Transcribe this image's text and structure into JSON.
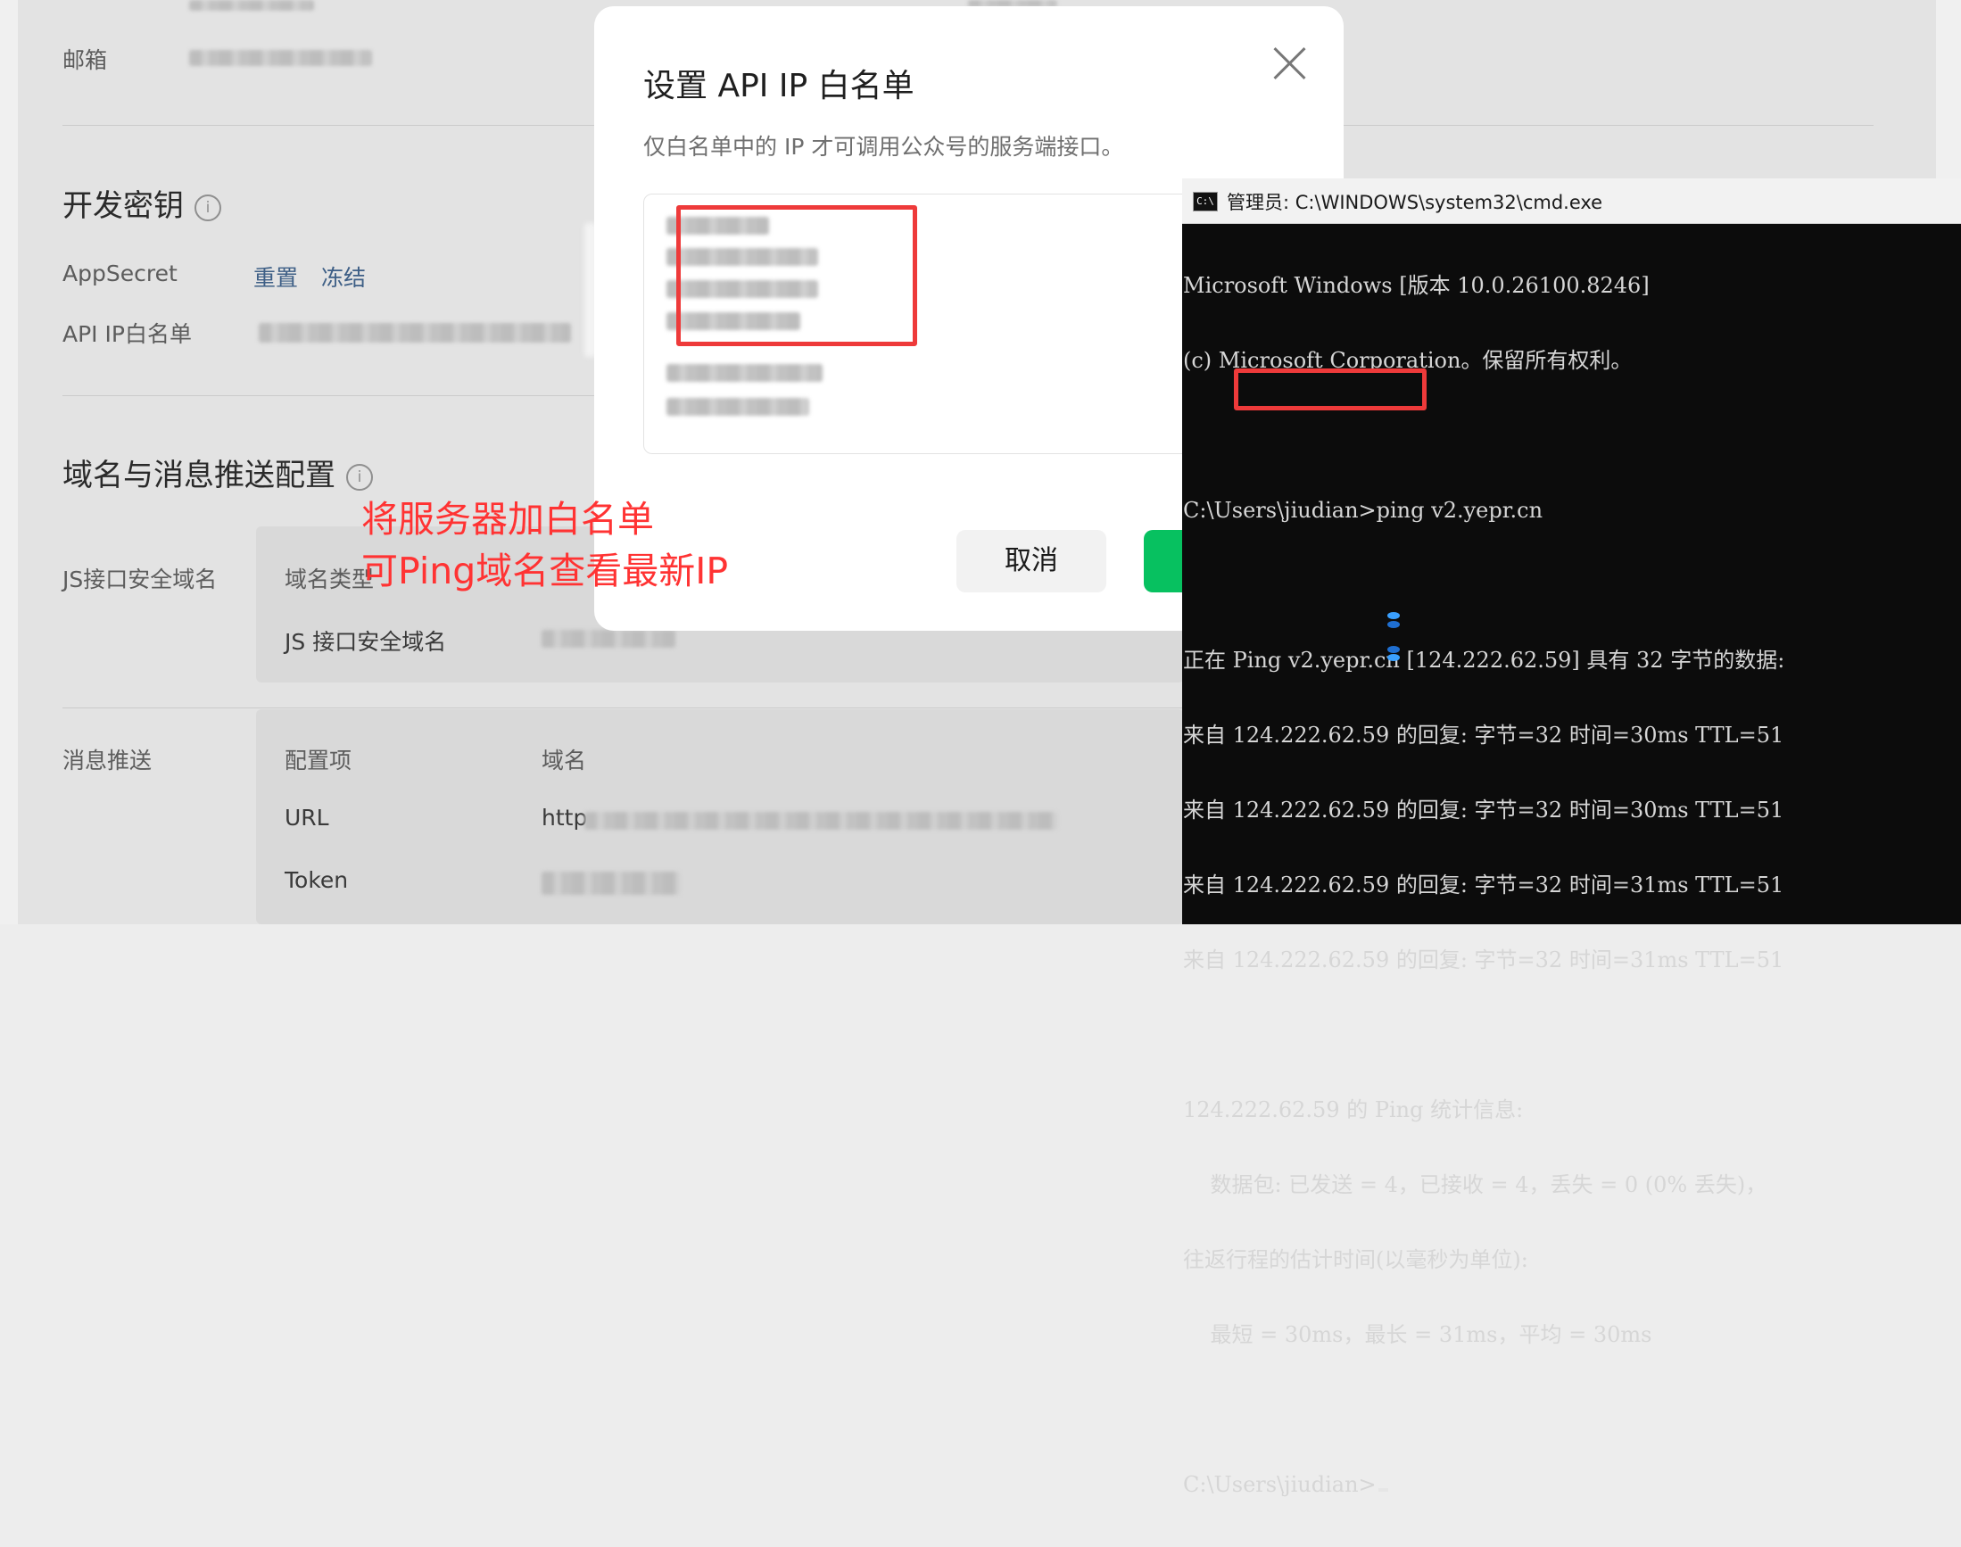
{
  "background": {
    "email_label": "邮箱",
    "dev_key_title": "开发密钥",
    "app_secret_label": "AppSecret",
    "reset_link": "重置",
    "freeze_link": "冻结",
    "api_ip_label": "API IP白名单",
    "domain_config_title": "域名与消息推送配置",
    "js_domain_label": "JS接口安全域名",
    "domain_type_label": "域名类型",
    "js_domain_field_label": "JS 接口安全域名",
    "push_label": "消息推送",
    "config_item_label": "配置项",
    "domain_col_label": "域名",
    "url_label": "URL",
    "url_value_prefix": "http",
    "token_label": "Token"
  },
  "modal": {
    "title": "设置 API IP 白名单",
    "description": "仅白名单中的 IP 才可调用公众号的服务端接口。",
    "cancel_label": "取消"
  },
  "annotation": {
    "line1": "将服务器加白名单",
    "line2": "可Ping域名查看最新IP",
    "color": "#ff3333"
  },
  "cmd": {
    "title": "管理员: C:\\WINDOWS\\system32\\cmd.exe",
    "lines": [
      "Microsoft Windows [版本 10.0.26100.8246]",
      "(c) Microsoft Corporation。保留所有权利。",
      "",
      "C:\\Users\\jiudian>ping v2.yepr.cn",
      "",
      "正在 Ping v2.yepr.cn [124.222.62.59] 具有 32 字节的数据:",
      "来自 124.222.62.59 的回复: 字节=32 时间=30ms TTL=51",
      "来自 124.222.62.59 的回复: 字节=32 时间=30ms TTL=51",
      "来自 124.222.62.59 的回复: 字节=32 时间=31ms TTL=51",
      "来自 124.222.62.59 的回复: 字节=32 时间=31ms TTL=51",
      "",
      "124.222.62.59 的 Ping 统计信息:",
      "    数据包: 已发送 = 4，已接收 = 4，丢失 = 0 (0% 丢失)，",
      "往返行程的估计时间(以毫秒为单位):",
      "    最短 = 30ms，最长 = 31ms，平均 = 30ms",
      ""
    ],
    "prompt": "C:\\Users\\jiudian>"
  },
  "colors": {
    "accent_green": "#07c160",
    "highlight_red": "#ee3a3a",
    "link_blue": "#3e5f86"
  }
}
